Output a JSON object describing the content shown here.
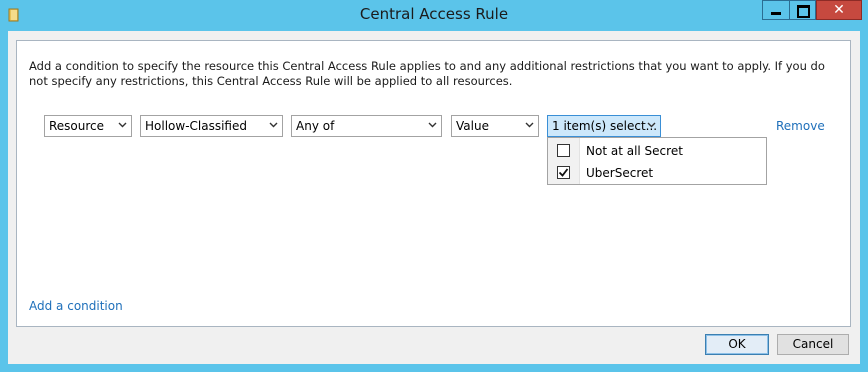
{
  "window": {
    "title": "Central Access Rule",
    "close_glyph": "✕"
  },
  "intro_text": "Add a condition to specify the resource this Central Access Rule applies to and any additional restrictions that you want to apply. If you do not specify any restrictions, this Central Access Rule will be applied to all resources.",
  "condition": {
    "scope": "Resource",
    "attribute": "Hollow-Classified",
    "operator": "Any of",
    "value_type": "Value",
    "values_summary": "1 item(s) select...",
    "remove_label": "Remove"
  },
  "value_options": [
    {
      "label": "Not at all Secret",
      "checked": false
    },
    {
      "label": "UberSecret",
      "checked": true
    }
  ],
  "add_condition_label": "Add a condition",
  "buttons": {
    "ok": "OK",
    "cancel": "Cancel"
  },
  "icons": [
    "folder-icon",
    "minimize-icon",
    "maximize-icon",
    "close-icon",
    "chevron-down-icon",
    "checkmark-icon"
  ],
  "colors": {
    "titlebar": "#5bc4ea",
    "close_button": "#c6493f",
    "link": "#1e6fba",
    "focused_combo": "#cde8fb"
  }
}
